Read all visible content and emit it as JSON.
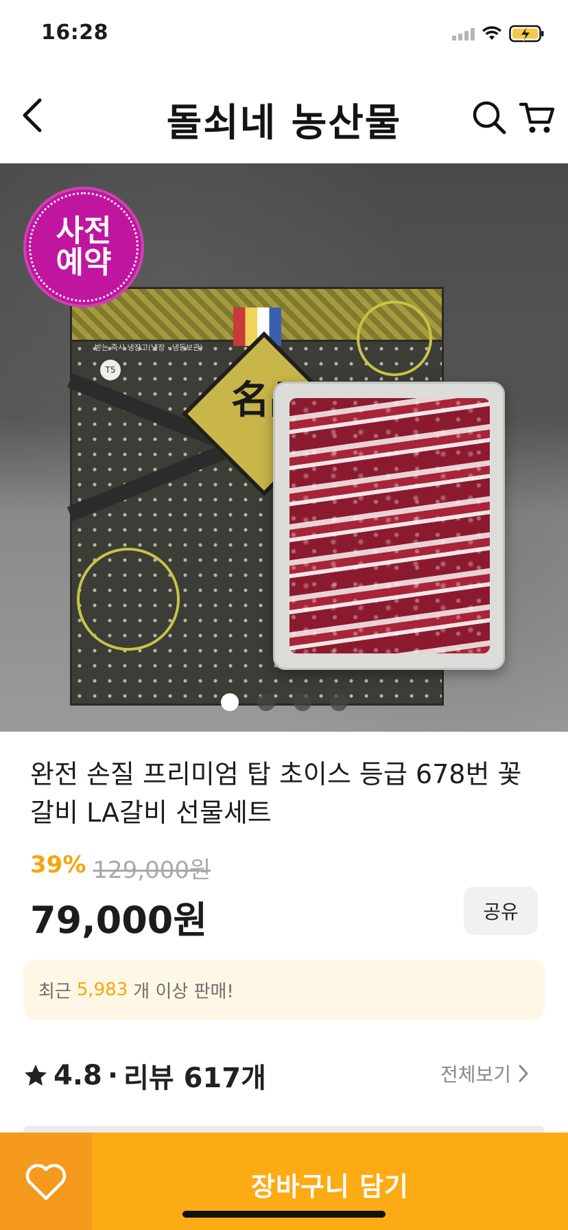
{
  "status_bar": {
    "time": "16:28",
    "icons": [
      "signal-icon",
      "wifi-icon",
      "battery-charging-icon"
    ]
  },
  "header": {
    "back_icon": "chevron-left-icon",
    "title": "돌쇠네 농산물",
    "search_icon": "search-icon",
    "cart_icon": "cart-icon"
  },
  "hero": {
    "badge_line1": "사전",
    "badge_line2": "예약",
    "box_hanja": "名品",
    "box_caption": "받는 즉시 냉장고(냉장 · 냉동보관)",
    "box_tag": "T5",
    "slide_count": 4,
    "active_slide": 1
  },
  "product": {
    "title": "완전 손질 프리미엄 탑 초이스 등급 678번 꽃갈비 LA갈비 선물세트",
    "discount_rate": "39%",
    "original_price": "129,000원",
    "sale_price": "79,000원",
    "share_label": "공유"
  },
  "sales": {
    "prefix": "최근",
    "count": "5,983",
    "suffix": "개 이상 판매!"
  },
  "reviews": {
    "rating": "4.8",
    "separator": "·",
    "review_label": "리뷰 617개",
    "see_all_label": "전체보기"
  },
  "bottom_bar": {
    "wish_icon": "heart-icon",
    "add_to_cart_label": "장바구니 담기"
  },
  "colors": {
    "accent": "#f5a60c",
    "cart_button": "#fcab14",
    "wish_button": "#f59a1d",
    "badge": "#c0159f",
    "sales_box_bg": "#fef7e5"
  }
}
